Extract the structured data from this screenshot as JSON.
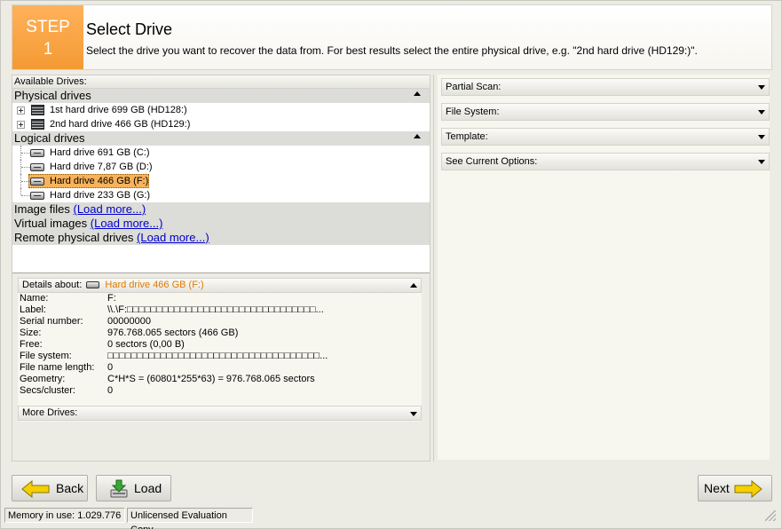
{
  "header": {
    "step_word": "STEP",
    "step_number": "1",
    "title": "Select Drive",
    "description": "Select the drive you want to recover the data from. For best results select the entire physical drive, e.g. \"2nd hard drive (HD129:)\"."
  },
  "drives": {
    "available_label": "Available Drives:",
    "physical_label": "Physical drives",
    "physical": [
      {
        "label": "1st hard drive 699 GB (HD128:)"
      },
      {
        "label": "2nd hard drive 466 GB (HD129:)"
      }
    ],
    "logical_label": "Logical drives",
    "logical": [
      {
        "label": "Hard drive 691 GB (C:)"
      },
      {
        "label": "Hard drive 7,87 GB (D:)"
      },
      {
        "label": "Hard drive 466 GB (F:)",
        "selected": true
      },
      {
        "label": "Hard drive 233 GB (G:)"
      }
    ],
    "image_files_label": "Image files",
    "virtual_images_label": "Virtual images",
    "remote_label": "Remote physical drives",
    "load_more_label": "(Load more...)"
  },
  "details": {
    "header_label": "Details about:",
    "selected_drive": "Hard drive 466 GB (F:)",
    "rows": [
      {
        "key": "Name:",
        "value": "F:"
      },
      {
        "key": "Label:",
        "value": "\\\\.\\F:□□□□□□□□□□□□□□□□□□□□□□□□□□□□□□□□..."
      },
      {
        "key": "Serial number:",
        "value": "00000000"
      },
      {
        "key": "Size:",
        "value": "976.768.065 sectors (466 GB)"
      },
      {
        "key": "Free:",
        "value": "0 sectors (0,00 B)"
      },
      {
        "key": "File system:",
        "value": "□□□□□□□□□□□□□□□□□□□□□□□□□□□□□□□□□□□□..."
      },
      {
        "key": "File name length:",
        "value": "0"
      },
      {
        "key": "Geometry:",
        "value": "C*H*S = (60801*255*63) = 976.768.065 sectors"
      },
      {
        "key": "Secs/cluster:",
        "value": "0"
      }
    ],
    "more_drives_label": "More Drives:"
  },
  "options": {
    "partial_scan": "Partial Scan:",
    "file_system": "File System:",
    "template": "Template:",
    "see_current_options": "See Current Options:"
  },
  "buttons": {
    "back": "Back",
    "load": "Load",
    "next": "Next"
  },
  "status": {
    "memory": "Memory in use: 1.029.776",
    "license": "Unlicensed Evaluation Copy"
  },
  "colors": {
    "accent_orange": "#f49a34",
    "selection": "#f7b25a",
    "link": "#0000cc",
    "arrow_yellow": "#f5d000"
  }
}
